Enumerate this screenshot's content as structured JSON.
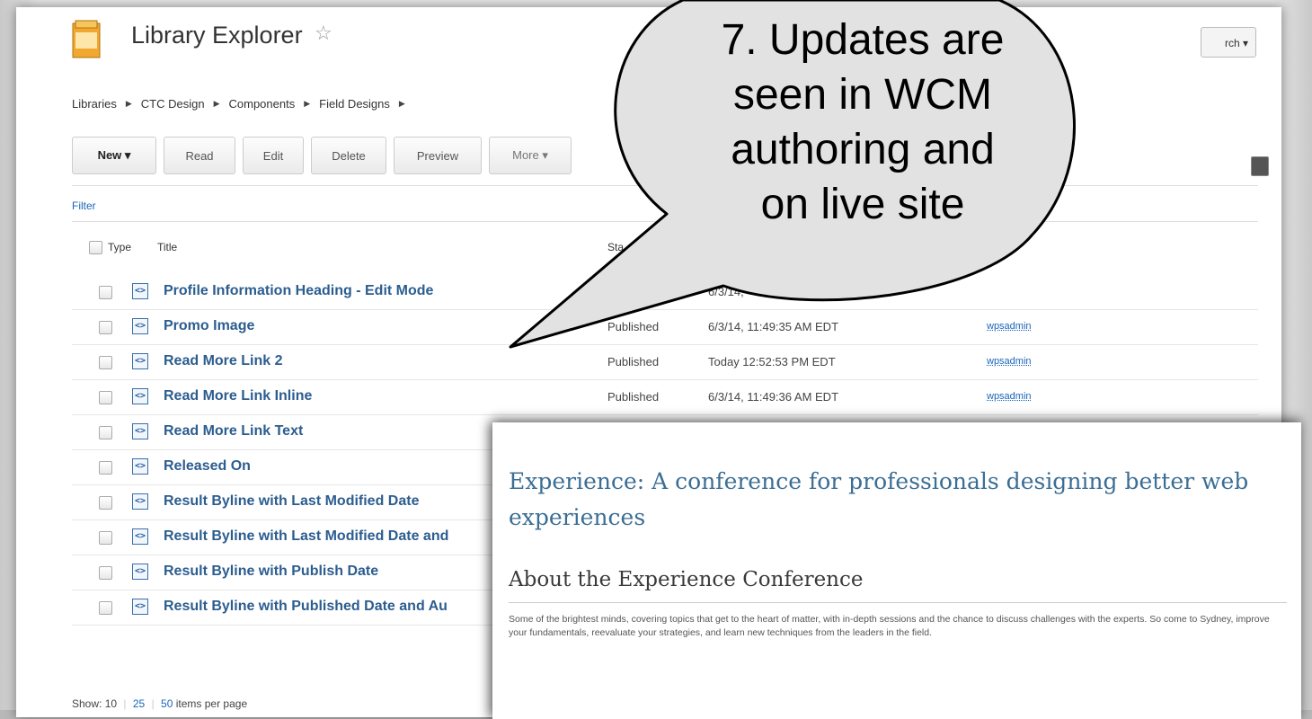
{
  "app": {
    "title": "Library Explorer",
    "star_icon": "star-outline-icon",
    "search_label": "rch ▾"
  },
  "breadcrumb": [
    "Libraries",
    "CTC Design",
    "Components",
    "Field Designs"
  ],
  "toolbar": {
    "new": "New ▾",
    "read": "Read",
    "edit": "Edit",
    "delete": "Delete",
    "preview": "Preview",
    "more": "More ▾"
  },
  "filter_label": "Filter",
  "table": {
    "headers": {
      "type": "Type",
      "title": "Title",
      "status": "Sta"
    },
    "rows": [
      {
        "title": "Profile Information Heading - Edit Mode",
        "status": "",
        "date": "6/3/14,",
        "author": ""
      },
      {
        "title": "Promo Image",
        "status": "Published",
        "date": "6/3/14, 11:49:35 AM EDT",
        "author": "wpsadmin"
      },
      {
        "title": "Read More Link 2",
        "status": "Published",
        "date": "Today 12:52:53 PM EDT",
        "author": "wpsadmin"
      },
      {
        "title": "Read More Link Inline",
        "status": "Published",
        "date": "6/3/14, 11:49:36 AM EDT",
        "author": "wpsadmin"
      },
      {
        "title": "Read More Link Text",
        "status": "",
        "date": "",
        "author": ""
      },
      {
        "title": "Released On",
        "status": "",
        "date": "",
        "author": ""
      },
      {
        "title": "Result Byline with Last Modified Date",
        "status": "",
        "date": "",
        "author": ""
      },
      {
        "title": "Result Byline with Last Modified Date and",
        "status": "",
        "date": "",
        "author": ""
      },
      {
        "title": "Result Byline with Publish Date",
        "status": "",
        "date": "",
        "author": ""
      },
      {
        "title": "Result Byline with Published Date and Au",
        "status": "",
        "date": "",
        "author": ""
      }
    ]
  },
  "pager": {
    "show_label": "Show:",
    "sizes": [
      "10",
      "25",
      "50"
    ],
    "suffix": "items per page"
  },
  "callout": {
    "line1": "7. Updates are",
    "line2": "seen in WCM",
    "line3": "authoring and",
    "line4": "on live site"
  },
  "preview": {
    "heading": "Experience: A conference for professionals designing better web experiences",
    "subheading": "About the Experience Conference",
    "body": "Some of the brightest minds, covering topics that get to the heart of matter, with in-depth sessions and the chance to discuss challenges with the experts. So come to Sydney, improve your fundamentals, reevaluate your strategies, and learn new techniques from the leaders in the field."
  }
}
